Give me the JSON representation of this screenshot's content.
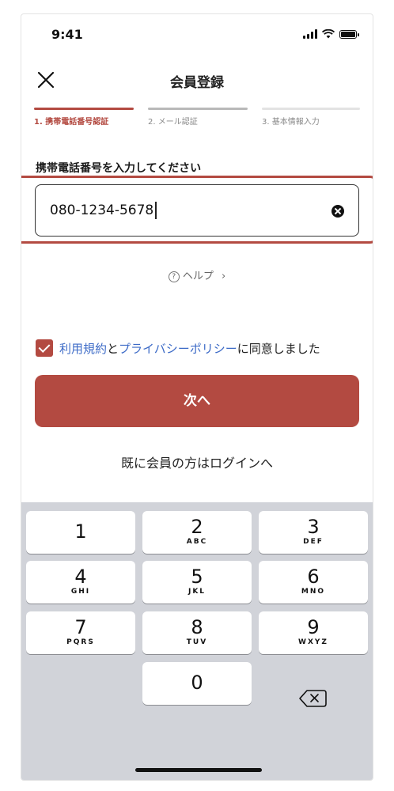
{
  "status_bar": {
    "time": "9:41"
  },
  "header": {
    "title": "会員登録"
  },
  "steps": [
    {
      "label": "1. 携帯電話番号認証",
      "state": "active"
    },
    {
      "label": "2. メール認証",
      "state": "pending"
    },
    {
      "label": "3. 基本情報入力",
      "state": "pending"
    }
  ],
  "form": {
    "prompt": "携帯電話番号を入力してください",
    "phone_value": "080-1234-5678"
  },
  "help": {
    "label": "ヘルプ",
    "chevron": "›"
  },
  "agreement": {
    "terms_link": "利用規約",
    "and_text": "と",
    "privacy_link": "プライバシーポリシー",
    "suffix": "に同意しました",
    "checked": true
  },
  "next_button": "次へ",
  "login_link": "既に会員の方はログインへ",
  "keyboard": {
    "keys": [
      {
        "num": "1",
        "letters": ""
      },
      {
        "num": "2",
        "letters": "ABC"
      },
      {
        "num": "3",
        "letters": "DEF"
      },
      {
        "num": "4",
        "letters": "GHI"
      },
      {
        "num": "5",
        "letters": "JKL"
      },
      {
        "num": "6",
        "letters": "MNO"
      },
      {
        "num": "7",
        "letters": "PQRS"
      },
      {
        "num": "8",
        "letters": "TUV"
      },
      {
        "num": "9",
        "letters": "WXYZ"
      },
      {
        "num": "0",
        "letters": ""
      }
    ]
  },
  "colors": {
    "accent": "#b34a41",
    "link": "#3d6bc7",
    "keyboard_bg": "#d1d3d9"
  }
}
